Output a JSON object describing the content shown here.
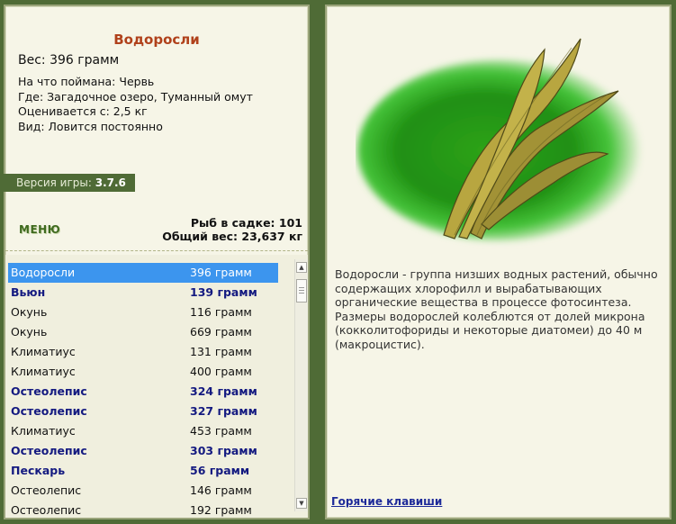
{
  "fish": {
    "name": "Водоросли",
    "weight_line": "Вес: 396 грамм",
    "caught_on": "На что поймана: Червь",
    "location": "Где: Загадочное озеро, Туманный омут",
    "value_from": "Оценивается с: 2,5 кг",
    "availability": "Вид: Ловится постоянно",
    "description": "Водоросли - группа низших водных растений, обычно содержащих хлорофилл и вырабатывающих органические вещества в процессе фотосинтеза. Размеры водорослей колеблются от долей микрона (кокколитофориды и некоторые диатомеи) до 40 м (макроцистис)."
  },
  "version": {
    "label": "Версия игры: ",
    "number": "3.7.6"
  },
  "menu_label": "МЕНЮ",
  "stats": {
    "fish_count": "Рыб в садке: 101",
    "total_weight": "Общий вес: 23,637 кг"
  },
  "list": [
    {
      "name": "Водоросли",
      "weight": "396 грамм",
      "bold": false,
      "selected": true
    },
    {
      "name": "Вьюн",
      "weight": "139 грамм",
      "bold": true,
      "selected": false
    },
    {
      "name": "Окунь",
      "weight": "116 грамм",
      "bold": false,
      "selected": false
    },
    {
      "name": "Окунь",
      "weight": "669 грамм",
      "bold": false,
      "selected": false
    },
    {
      "name": "Климатиус",
      "weight": "131 грамм",
      "bold": false,
      "selected": false
    },
    {
      "name": "Климатиус",
      "weight": "400 грамм",
      "bold": false,
      "selected": false
    },
    {
      "name": "Остеолепис",
      "weight": "324 грамм",
      "bold": true,
      "selected": false
    },
    {
      "name": "Остеолепис",
      "weight": "327 грамм",
      "bold": true,
      "selected": false
    },
    {
      "name": "Климатиус",
      "weight": "453 грамм",
      "bold": false,
      "selected": false
    },
    {
      "name": "Остеолепис",
      "weight": "303 грамм",
      "bold": true,
      "selected": false
    },
    {
      "name": "Пескарь",
      "weight": "56 грамм",
      "bold": true,
      "selected": false
    },
    {
      "name": "Остеолепис",
      "weight": "146 грамм",
      "bold": false,
      "selected": false
    },
    {
      "name": "Остеолепис",
      "weight": "192 грамм",
      "bold": false,
      "selected": false
    }
  ],
  "hotkeys_label": "Горячие клавиши",
  "colors": {
    "background": "#4f6b36",
    "panel": "#f6f5e7",
    "selected": "#3c95ee",
    "bold_text": "#141a80",
    "title": "#b0411b"
  }
}
